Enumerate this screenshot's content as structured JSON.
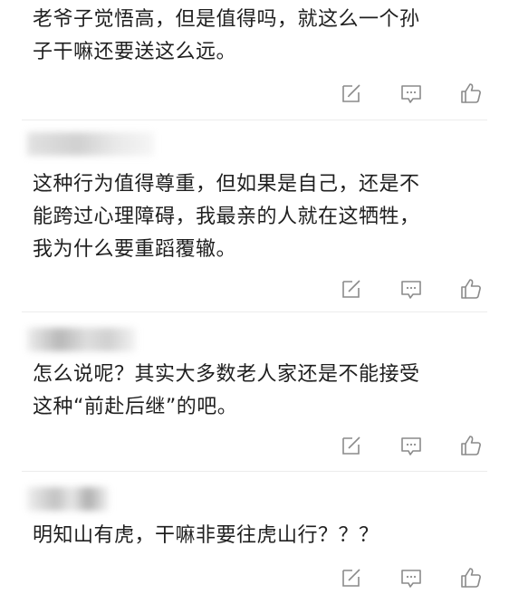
{
  "comments": [
    {
      "text": "老爷子觉悟高，但是值得吗，就这么一个孙\n子干嘛还要送这么远。"
    },
    {
      "text": "这种行为值得尊重，但如果是自己，还是不\n能跨过心理障碍，我最亲的人就在这牺牲，\n我为什么要重蹈覆辙。"
    },
    {
      "text": "怎么说呢？其实大多数老人家还是不能接受\n这种“前赴后继”的吧。"
    },
    {
      "text": "明知山有虎，干嘛非要往虎山行？？？"
    }
  ],
  "icons": {
    "edit": "edit-icon",
    "reply": "comment-icon",
    "like": "thumbs-up-icon"
  },
  "colors": {
    "icon": "#8a8a8a",
    "text": "#1f1f1f",
    "divider": "#ececec"
  }
}
